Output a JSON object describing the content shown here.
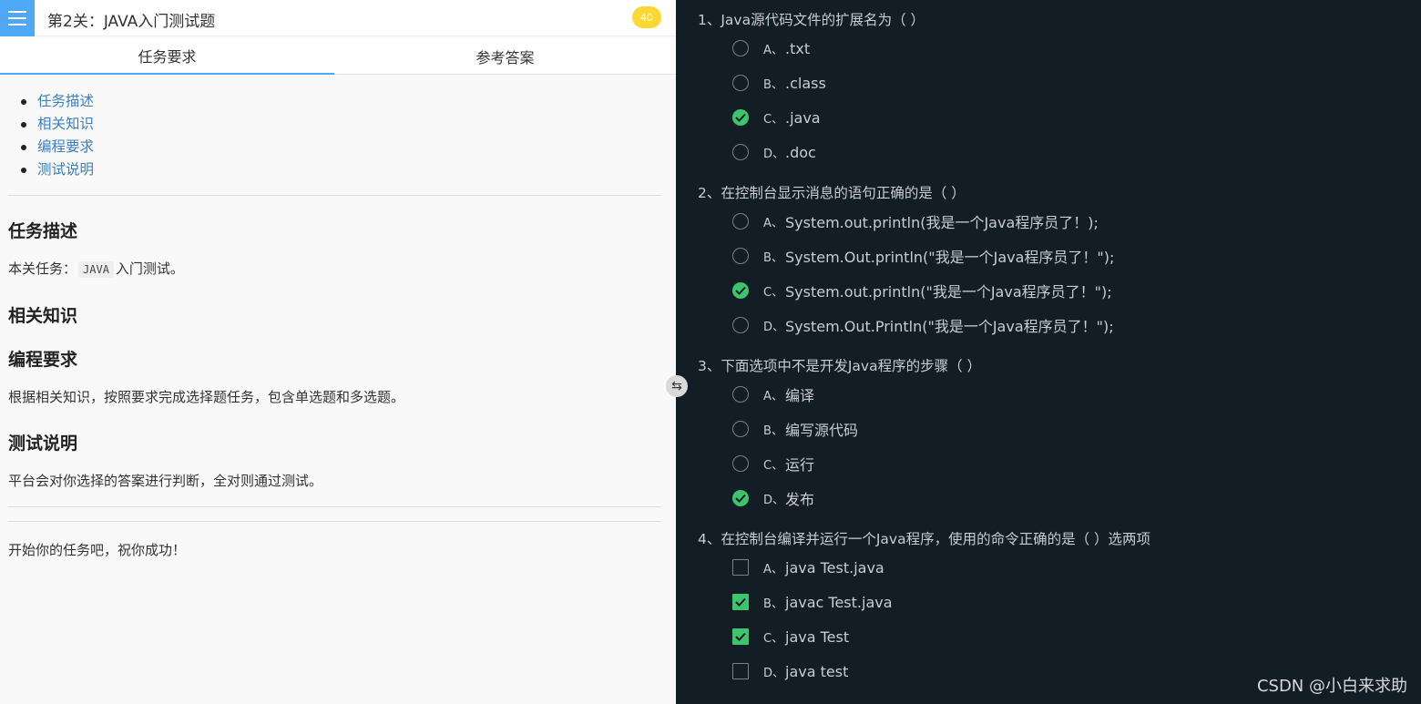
{
  "header": {
    "title": "第2关：JAVA入门测试题",
    "score": "40",
    "accent": "#4fa8f5",
    "badge_color": "#fdd835"
  },
  "tabs": [
    {
      "label": "任务要求",
      "active": true
    },
    {
      "label": "参考答案",
      "active": false
    }
  ],
  "toc": [
    "任务描述",
    "相关知识",
    "编程要求",
    "测试说明"
  ],
  "sections": {
    "task_title": "任务描述",
    "task_prefix": "本关任务：",
    "task_code": "JAVA",
    "task_suffix": "入门测试。",
    "knowledge_title": "相关知识",
    "requirements_title": "编程要求",
    "requirements_text": "根据相关知识，按照要求完成选择题任务，包含单选题和多选题。",
    "test_title": "测试说明",
    "test_text": "平台会对你选择的答案进行判断，全对则通过测试。",
    "closing": "开始你的任务吧，祝你成功！"
  },
  "toggle_icon": "swap-icon",
  "questions": [
    {
      "text": "1、Java源代码文件的扩展名为（ ）",
      "type": "radio",
      "options": [
        {
          "letter": "A、",
          "text": ".txt",
          "checked": false
        },
        {
          "letter": "B、",
          "text": ".class",
          "checked": false
        },
        {
          "letter": "C、",
          "text": ".java",
          "checked": true
        },
        {
          "letter": "D、",
          "text": ".doc",
          "checked": false
        }
      ]
    },
    {
      "text": "2、在控制台显示消息的语句正确的是（ ）",
      "type": "radio",
      "options": [
        {
          "letter": "A、",
          "text": "System.out.println(我是一个Java程序员了！);",
          "checked": false
        },
        {
          "letter": "B、",
          "text": "System.Out.println(\"我是一个Java程序员了！\");",
          "checked": false
        },
        {
          "letter": "C、",
          "text": "System.out.println(\"我是一个Java程序员了！\");",
          "checked": true
        },
        {
          "letter": "D、",
          "text": "System.Out.Println(\"我是一个Java程序员了！\");",
          "checked": false
        }
      ]
    },
    {
      "text": "3、下面选项中不是开发Java程序的步骤（ ）",
      "type": "radio",
      "options": [
        {
          "letter": "A、",
          "text": "编译",
          "checked": false
        },
        {
          "letter": "B、",
          "text": "编写源代码",
          "checked": false
        },
        {
          "letter": "C、",
          "text": "运行",
          "checked": false
        },
        {
          "letter": "D、",
          "text": "发布",
          "checked": true
        }
      ]
    },
    {
      "text": "4、在控制台编译并运行一个Java程序，使用的命令正确的是（     ）选两项",
      "type": "checkbox",
      "options": [
        {
          "letter": "A、",
          "text": "java Test.java",
          "checked": false
        },
        {
          "letter": "B、",
          "text": "javac Test.java",
          "checked": true
        },
        {
          "letter": "C、",
          "text": "java Test",
          "checked": true
        },
        {
          "letter": "D、",
          "text": "java test",
          "checked": false
        }
      ]
    }
  ],
  "check_color": "#3ec46d",
  "watermark": "CSDN @小白来求助"
}
